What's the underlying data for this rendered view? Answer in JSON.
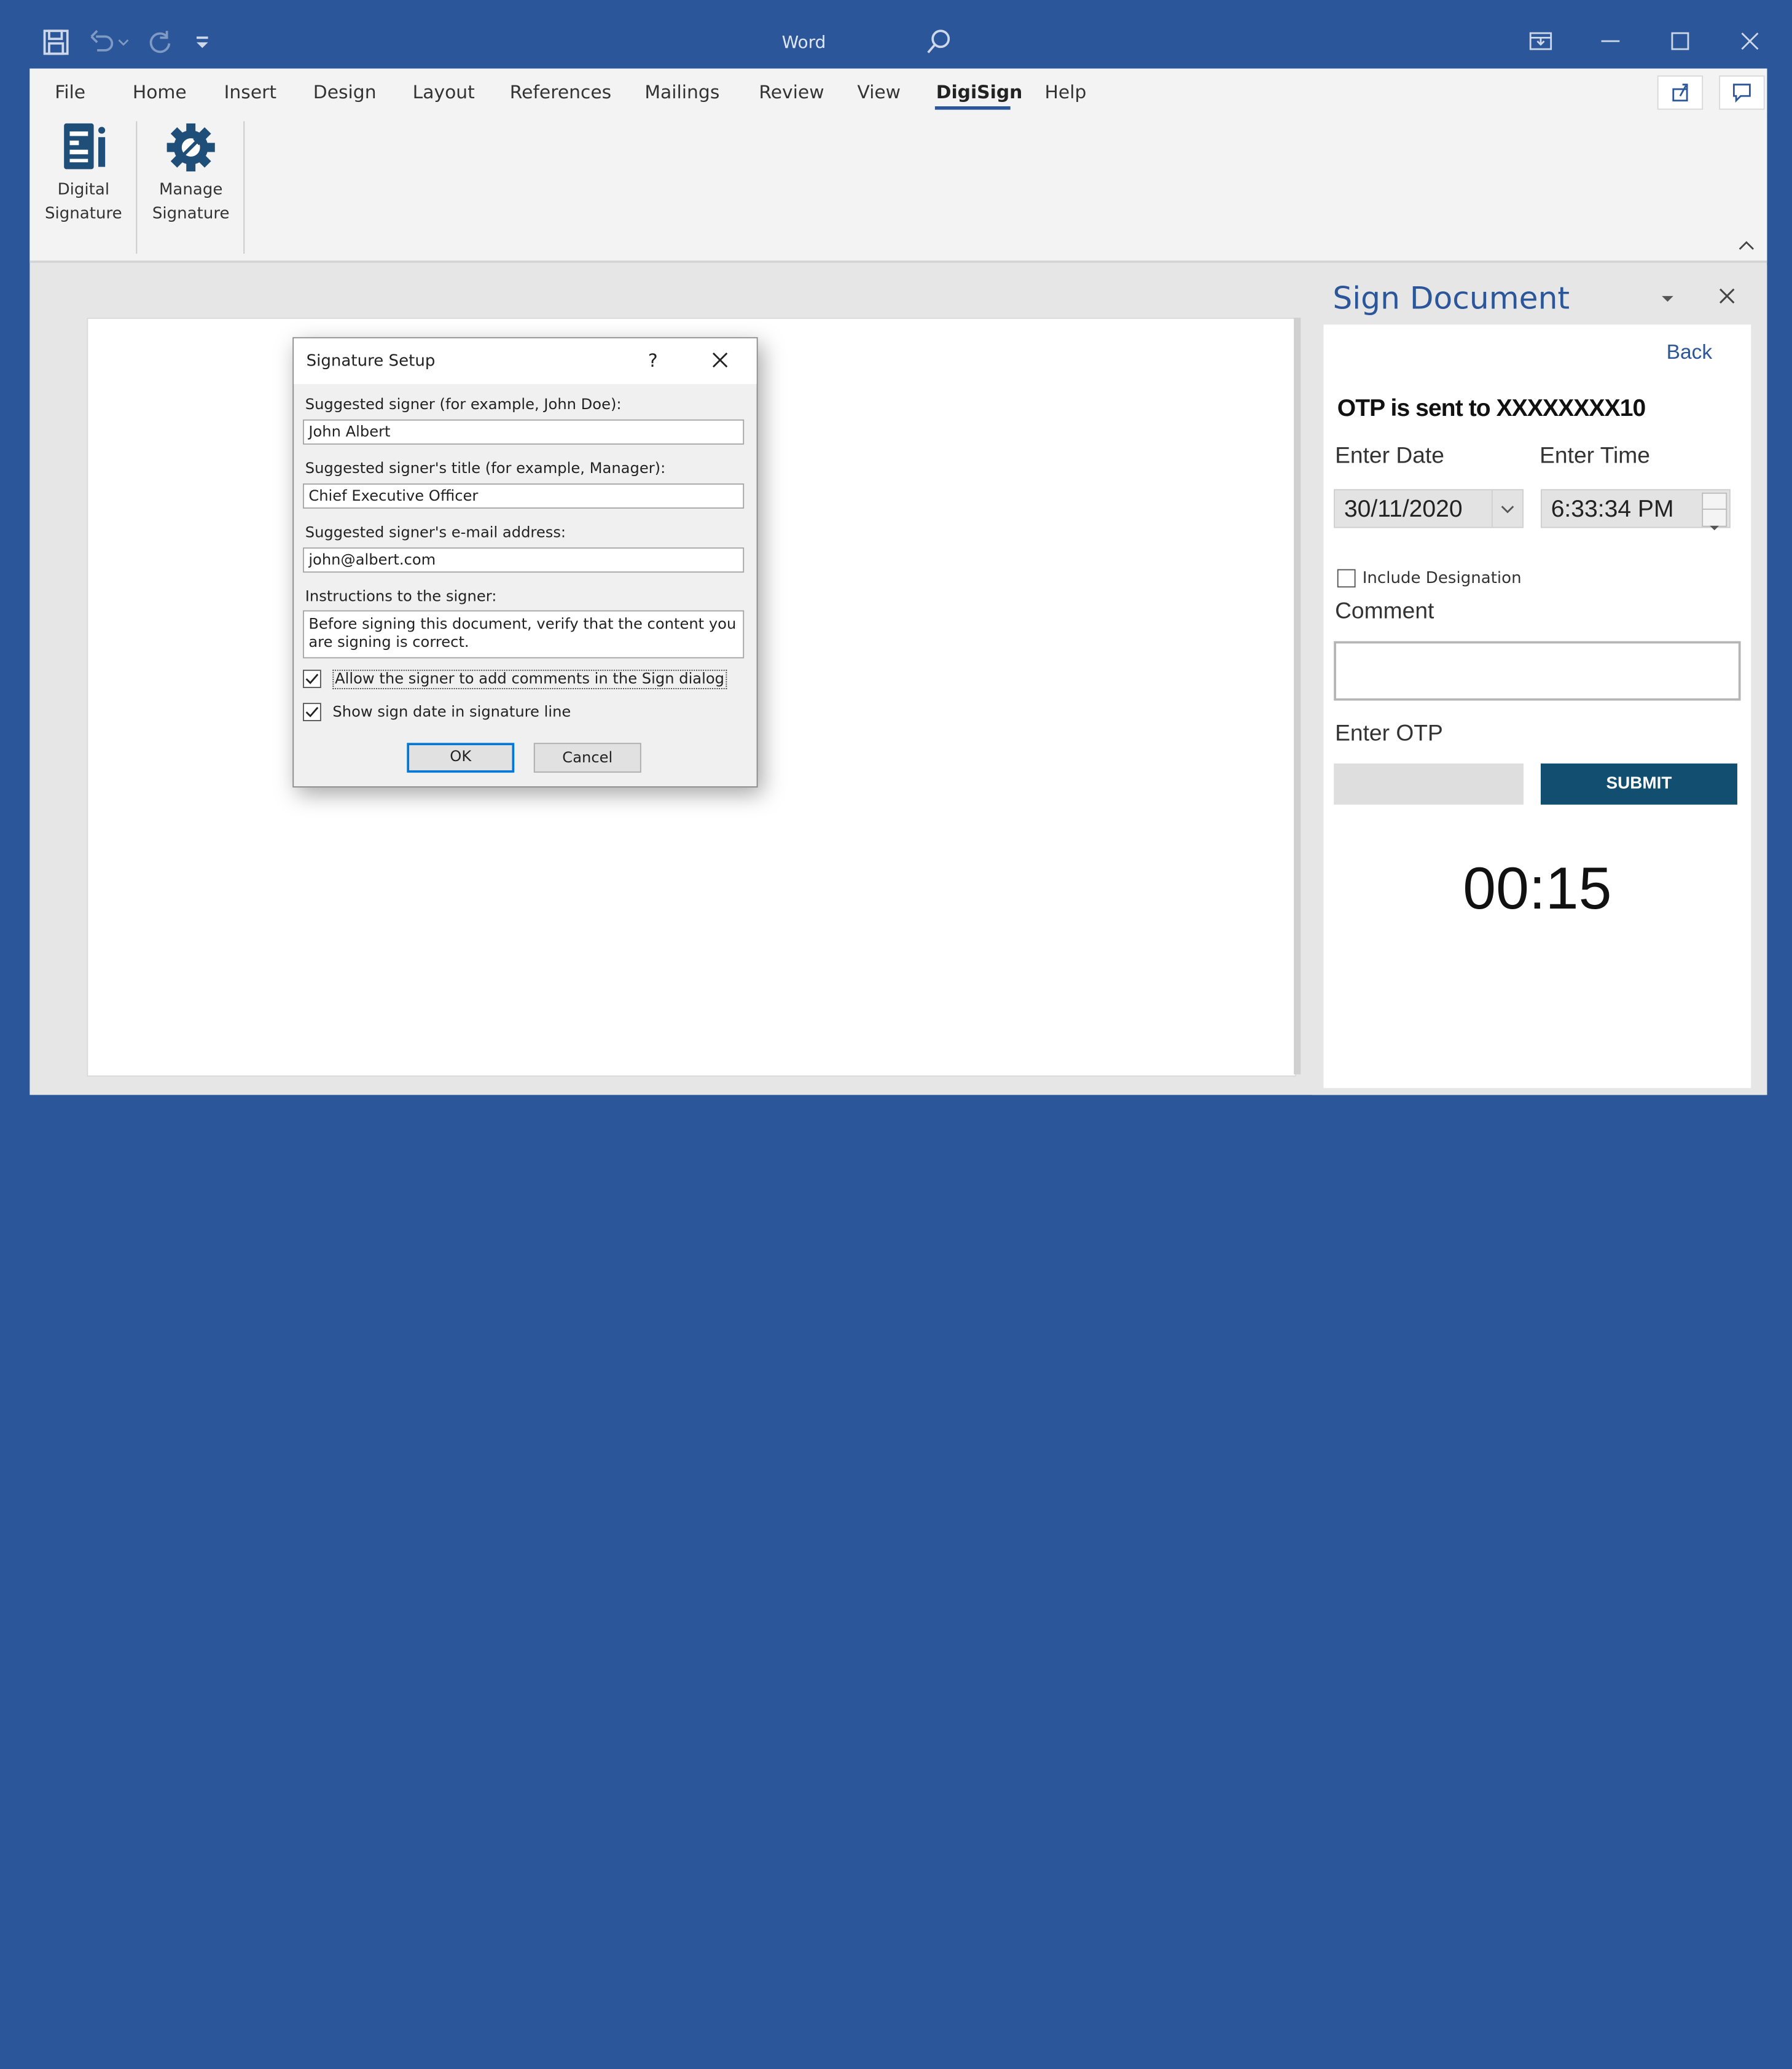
{
  "titlebar": {
    "app_title": "Word"
  },
  "ribbon": {
    "tabs": [
      "File",
      "Home",
      "Insert",
      "Design",
      "Layout",
      "References",
      "Mailings",
      "Review",
      "View",
      "DigiSign",
      "Help"
    ],
    "active_tab": "DigiSign",
    "buttons": [
      {
        "line1": "Digital",
        "line2": "Signature"
      },
      {
        "line1": "Manage",
        "line2": "Signature"
      }
    ]
  },
  "dialog": {
    "title": "Signature Setup",
    "help": "?",
    "signer_label": "Suggested signer (for example, John Doe):",
    "signer_value": "John Albert",
    "title_label": "Suggested signer's title (for example, Manager):",
    "title_value": "Chief Executive Officer",
    "email_label": "Suggested signer's e-mail address:",
    "email_value": "john@albert.com",
    "instructions_label": "Instructions to the signer:",
    "instructions_value": "Before signing this document, verify that the content you are signing is correct.",
    "allow_comments_label": "Allow the signer to add comments in the Sign dialog",
    "allow_comments_checked": true,
    "show_date_label": "Show sign date in signature line",
    "show_date_checked": true,
    "ok_label": "OK",
    "cancel_label": "Cancel"
  },
  "pane": {
    "title": "Sign Document",
    "back_label": "Back",
    "otp_message": "OTP is sent to XXXXXXXX10",
    "date_label": "Enter Date",
    "date_value": "30/11/2020",
    "time_label": "Enter Time",
    "time_value": "6:33:34 PM",
    "include_designation_label": "Include Designation",
    "include_designation_checked": false,
    "comment_label": "Comment",
    "comment_value": "",
    "otp_label": "Enter OTP",
    "otp_value": "",
    "submit_label": "SUBMIT",
    "timer": "00:15"
  },
  "colors": {
    "word_blue": "#2b579a",
    "submit_bg": "#124e6f",
    "pane_title": "#2b579a"
  }
}
